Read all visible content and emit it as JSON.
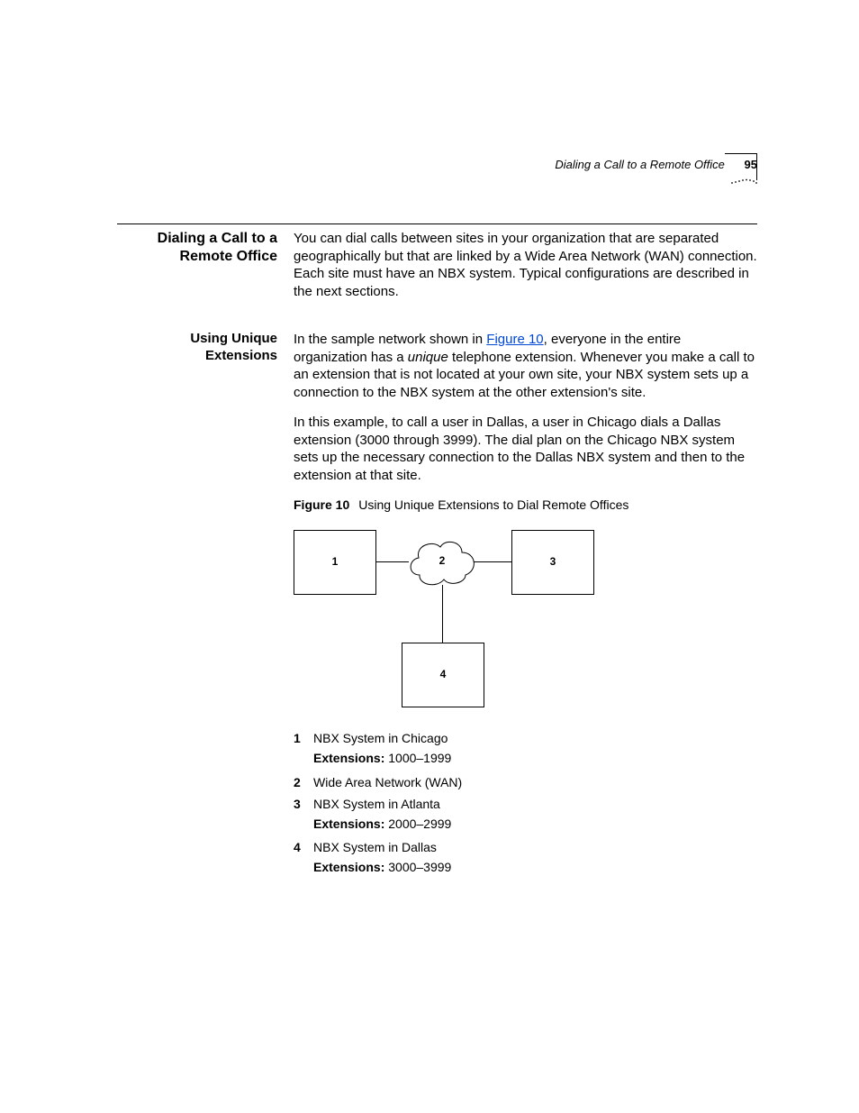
{
  "header": {
    "running_title": "Dialing a Call to a Remote Office",
    "page_number": "95"
  },
  "section": {
    "heading": "Dialing a Call to a Remote Office",
    "intro": "You can dial calls between sites in your organization that are separated geographically but that are linked by a Wide Area Network (WAN) connection. Each site must have an NBX system. Typical configurations are described in the next sections."
  },
  "subsection": {
    "heading": "Using Unique Extensions",
    "p1_a": "In the sample network shown in ",
    "p1_link": "Figure 10",
    "p1_b": ", everyone in the entire organization has a ",
    "p1_em": "unique",
    "p1_c": " telephone extension. Whenever you make a call to an extension that is not located at your own site, your NBX system sets up a connection to the NBX system at the other extension's site.",
    "p2": "In this example, to call a user in Dallas, a user in Chicago dials a Dallas extension (3000 through 3999). The dial plan on the Chicago NBX system sets up the necessary connection to the Dallas NBX system and then to the extension at that site."
  },
  "figure": {
    "label": "Figure 10",
    "caption": "Using Unique Extensions to Dial Remote Offices",
    "nodes": {
      "n1": "1",
      "n2": "2",
      "n3": "3",
      "n4": "4"
    },
    "legend": [
      {
        "num": "1",
        "text": "NBX System in Chicago",
        "ext_label": "Extensions:",
        "ext_value": "1000–1999"
      },
      {
        "num": "2",
        "text": "Wide Area Network (WAN)"
      },
      {
        "num": "3",
        "text": "NBX System in Atlanta",
        "ext_label": "Extensions:",
        "ext_value": "2000–2999"
      },
      {
        "num": "4",
        "text": "NBX System in Dallas",
        "ext_label": "Extensions:",
        "ext_value": "3000–3999"
      }
    ]
  }
}
